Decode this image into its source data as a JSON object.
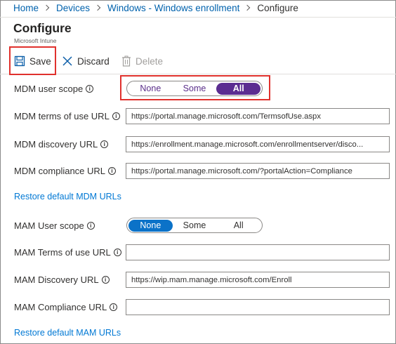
{
  "breadcrumb": {
    "items": [
      "Home",
      "Devices",
      "Windows - Windows enrollment"
    ],
    "current": "Configure"
  },
  "header": {
    "title": "Configure",
    "subtitle": "Microsoft Intune"
  },
  "toolbar": {
    "save_label": "Save",
    "discard_label": "Discard",
    "delete_label": "Delete"
  },
  "mdm": {
    "user_scope": {
      "label": "MDM user scope",
      "options": [
        "None",
        "Some",
        "All"
      ],
      "selected": "All"
    },
    "terms_url": {
      "label": "MDM terms of use URL",
      "value": "https://portal.manage.microsoft.com/TermsofUse.aspx"
    },
    "discovery_url": {
      "label": "MDM discovery URL",
      "value": "https://enrollment.manage.microsoft.com/enrollmentserver/disco..."
    },
    "compliance_url": {
      "label": "MDM compliance URL",
      "value": "https://portal.manage.microsoft.com/?portalAction=Compliance"
    },
    "restore_link": "Restore default MDM URLs"
  },
  "mam": {
    "user_scope": {
      "label": "MAM User scope",
      "options": [
        "None",
        "Some",
        "All"
      ],
      "selected": "None"
    },
    "terms_url": {
      "label": "MAM Terms of use URL",
      "value": ""
    },
    "discovery_url": {
      "label": "MAM Discovery URL",
      "value": "https://wip.mam.manage.microsoft.com/Enroll"
    },
    "compliance_url": {
      "label": "MAM Compliance URL",
      "value": ""
    },
    "restore_link": "Restore default MAM URLs"
  },
  "colors": {
    "link": "#0078d4",
    "mdm_selected": "#5b2d91",
    "mam_selected": "#0b72c8",
    "highlight": "#e0312d"
  },
  "icons": {
    "info": "i",
    "save": "save-icon",
    "discard": "discard-icon",
    "delete": "delete-icon"
  }
}
